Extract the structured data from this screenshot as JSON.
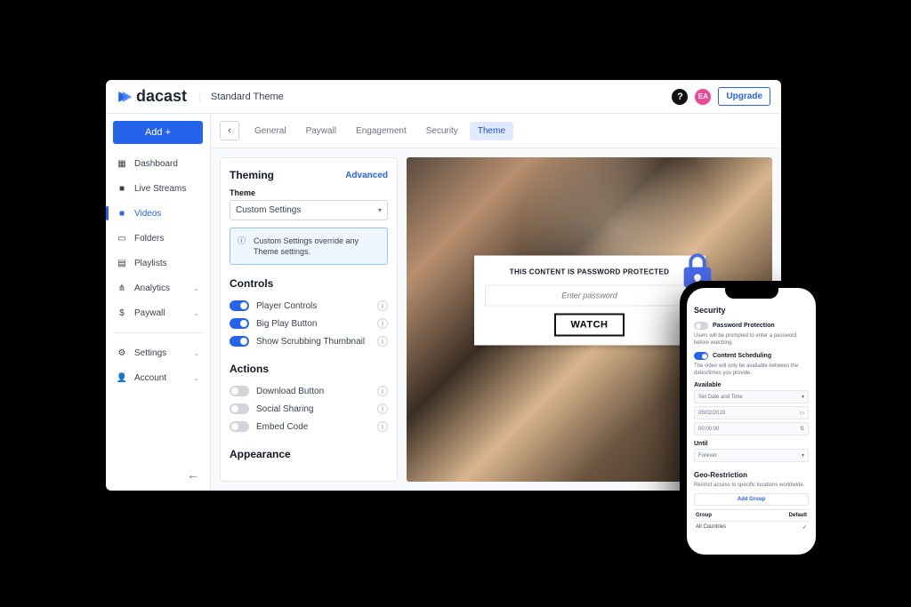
{
  "brand": "dacast",
  "header": {
    "breadcrumb": "Standard Theme",
    "avatar_initials": "EA",
    "upgrade_label": "Upgrade"
  },
  "sidebar": {
    "add_label": "Add +",
    "items": [
      {
        "label": "Dashboard",
        "icon": "dashboard-icon"
      },
      {
        "label": "Live Streams",
        "icon": "camera-icon"
      },
      {
        "label": "Videos",
        "icon": "video-icon",
        "active": true
      },
      {
        "label": "Folders",
        "icon": "folder-icon"
      },
      {
        "label": "Playlists",
        "icon": "playlist-icon"
      },
      {
        "label": "Analytics",
        "icon": "analytics-icon",
        "expandable": true
      },
      {
        "label": "Paywall",
        "icon": "paywall-icon",
        "expandable": true
      }
    ],
    "settings_items": [
      {
        "label": "Settings",
        "icon": "gear-icon",
        "expandable": true
      },
      {
        "label": "Account",
        "icon": "person-icon",
        "expandable": true
      }
    ]
  },
  "tabs": [
    "General",
    "Paywall",
    "Engagement",
    "Security",
    "Theme"
  ],
  "active_tab_index": 4,
  "theming": {
    "title": "Theming",
    "advanced_link": "Advanced",
    "theme_label": "Theme",
    "theme_value": "Custom Settings",
    "info_text": "Custom Settings override any Theme settings."
  },
  "controls": {
    "title": "Controls",
    "items": [
      {
        "label": "Player Controls",
        "on": true
      },
      {
        "label": "Big Play Button",
        "on": true
      },
      {
        "label": "Show Scrubbing Thumbnail",
        "on": true
      }
    ]
  },
  "actions": {
    "title": "Actions",
    "items": [
      {
        "label": "Download Button",
        "on": false
      },
      {
        "label": "Social Sharing",
        "on": false
      },
      {
        "label": "Embed Code",
        "on": false
      }
    ]
  },
  "appearance_title": "Appearance",
  "overlay": {
    "title": "THIS CONTENT IS PASSWORD PROTECTED",
    "placeholder": "Enter password",
    "button": "WATCH"
  },
  "phone": {
    "title": "Security",
    "password": {
      "label": "Password Protection",
      "desc": "Users will be prompted to enter a password before watching.",
      "on": false
    },
    "scheduling": {
      "label": "Content Scheduling",
      "desc": "The video will only be available between the dates/times you provide.",
      "on": true
    },
    "available_label": "Available",
    "available_mode": "Set Date and Time",
    "available_date": "05/02/2019",
    "available_time": "00:00:00",
    "until_label": "Until",
    "until_value": "Forever",
    "geo": {
      "title": "Geo-Restriction",
      "desc": "Restrict access to specific locations worldwide.",
      "add_group": "Add Group",
      "col_group": "Group",
      "col_default": "Default",
      "row_group": "All Countries",
      "row_default": "✓"
    }
  }
}
